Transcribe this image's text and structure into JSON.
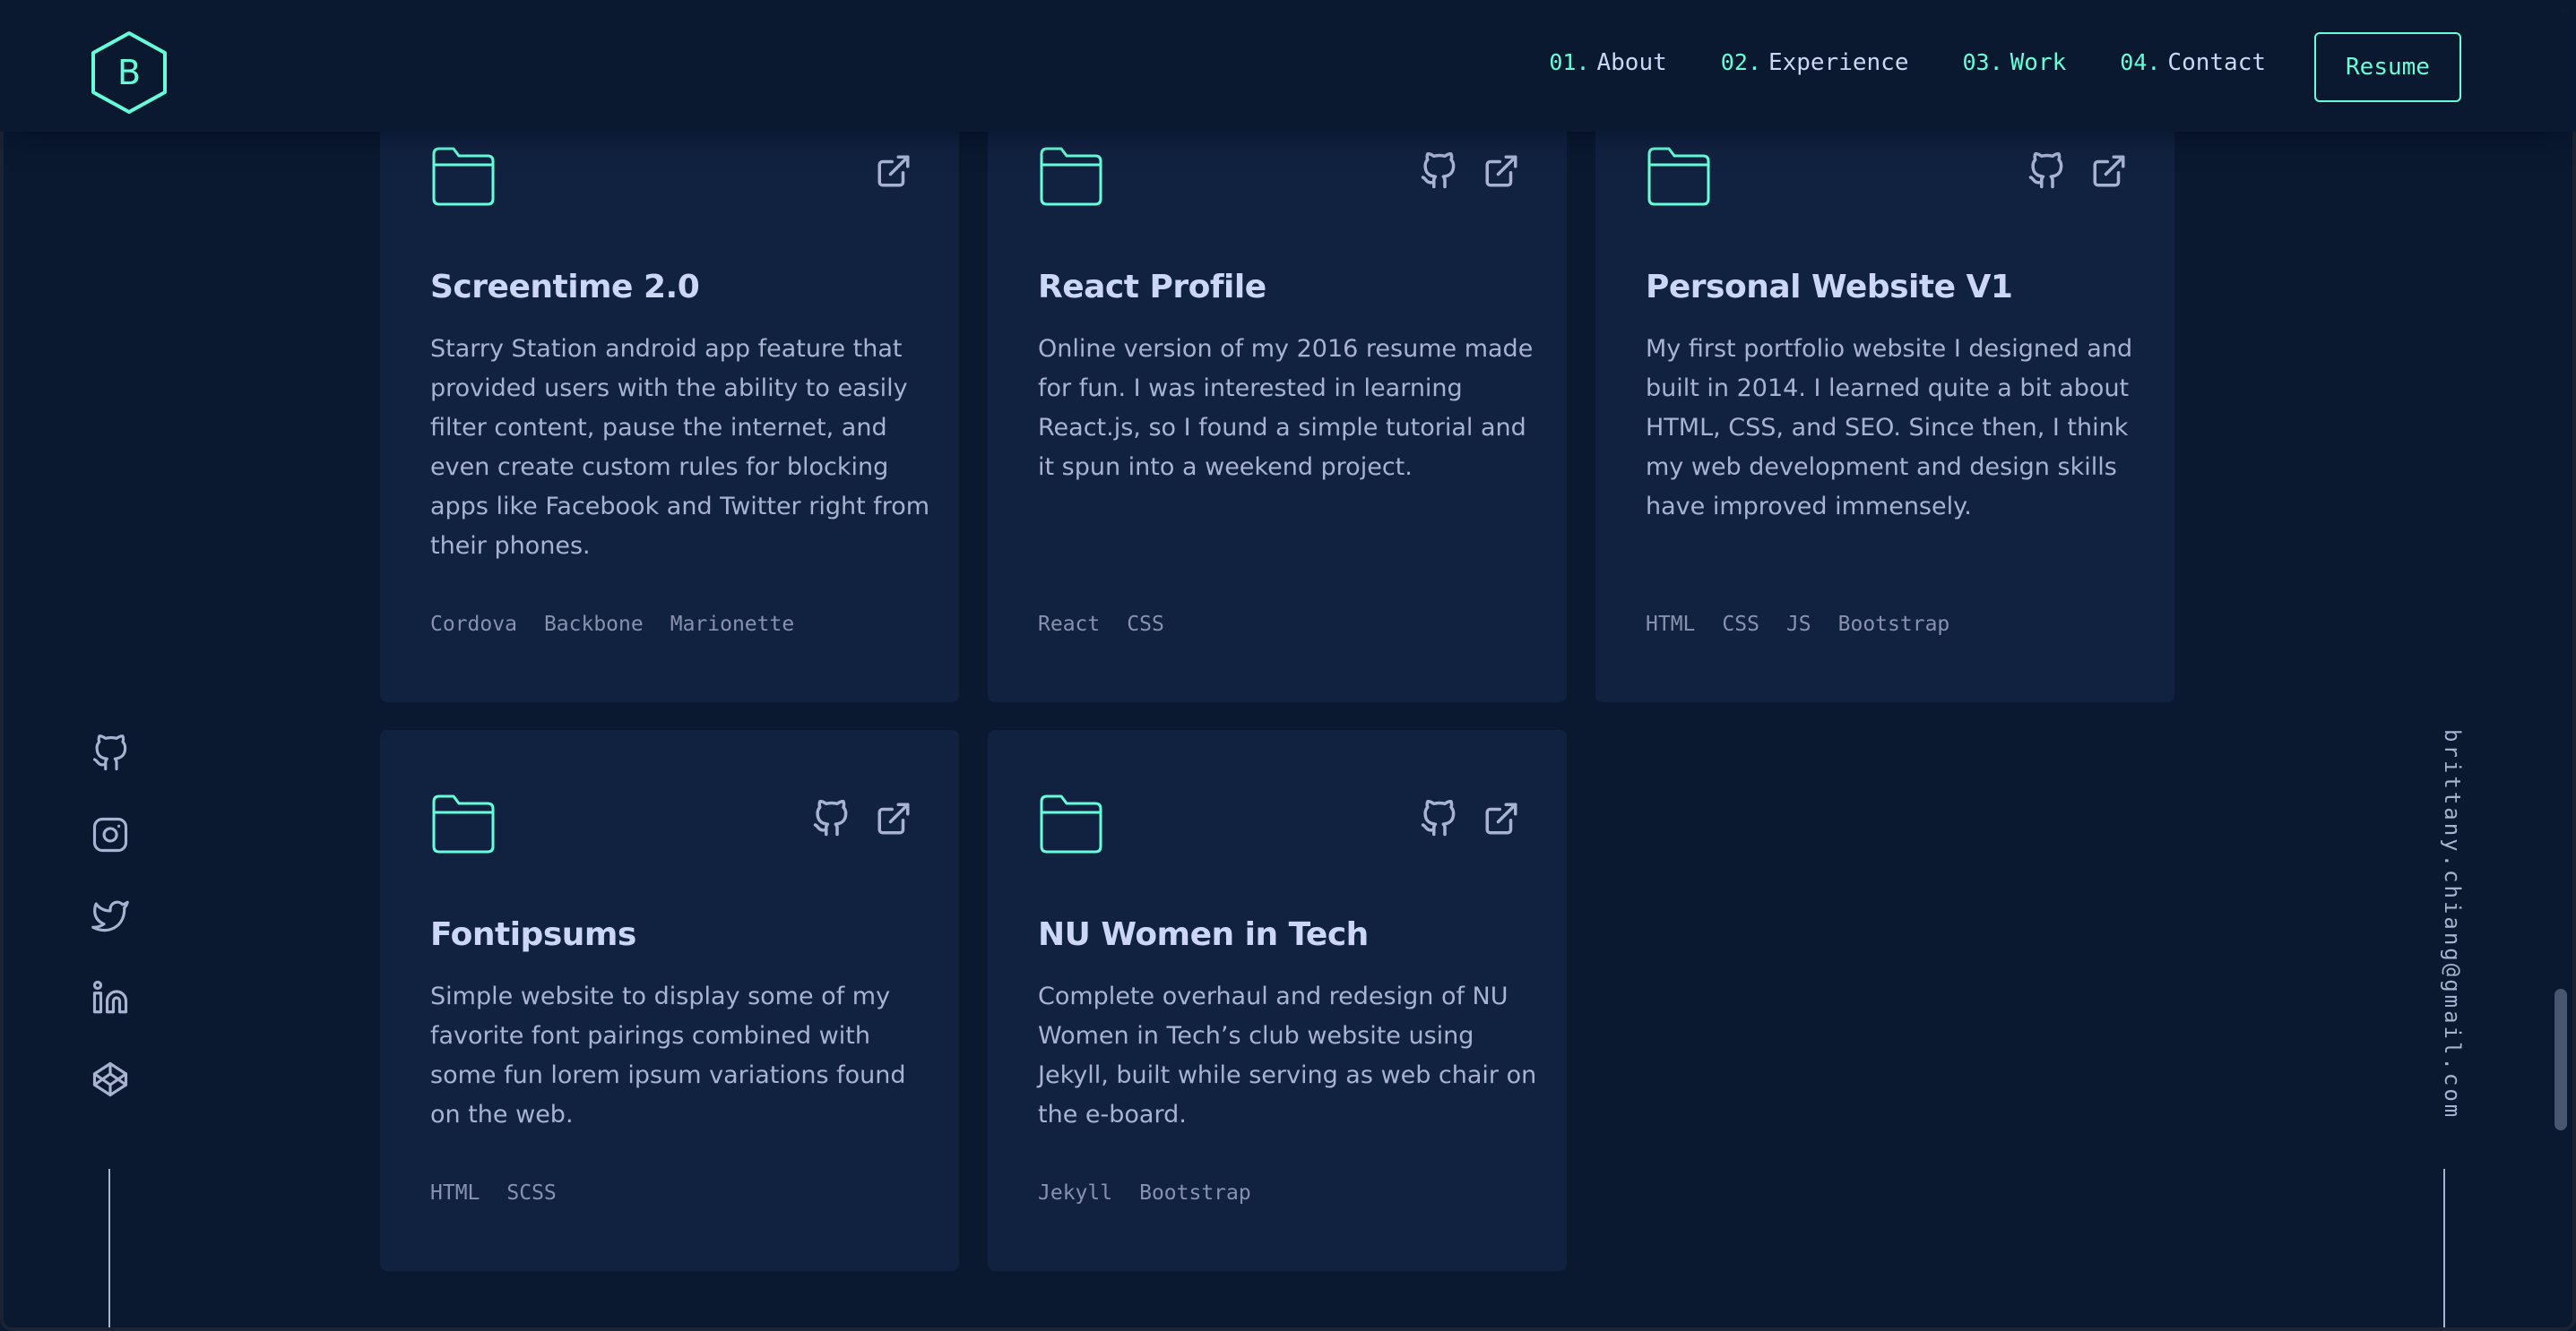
{
  "header": {
    "logo_letter": "B",
    "nav": [
      {
        "num": "01.",
        "label": "About"
      },
      {
        "num": "02.",
        "label": "Experience"
      },
      {
        "num": "03.",
        "label": "Work"
      },
      {
        "num": "04.",
        "label": "Contact"
      }
    ],
    "resume_label": "Resume"
  },
  "projects": [
    {
      "title": "Screentime 2.0",
      "description": "Starry Station android app feature that provided users with the ability to easily filter content, pause the internet, and even create custom rules for blocking apps like Facebook and Twitter right from their phones.",
      "tags": [
        "Cordova",
        "Backbone",
        "Marionette"
      ],
      "icons": [
        "external-link-icon"
      ]
    },
    {
      "title": "React Profile",
      "description": "Online version of my 2016 resume made for fun. I was interested in learning React.js, so I found a simple tutorial and it spun into a weekend project.",
      "tags": [
        "React",
        "CSS"
      ],
      "icons": [
        "github-icon",
        "external-link-icon"
      ]
    },
    {
      "title": "Personal Website V1",
      "description": "My first portfolio website I designed and built in 2014. I learned quite a bit about HTML, CSS, and SEO. Since then, I think my web development and design skills have improved immensely.",
      "tags": [
        "HTML",
        "CSS",
        "JS",
        "Bootstrap"
      ],
      "icons": [
        "github-icon",
        "external-link-icon"
      ]
    },
    {
      "title": "Fontipsums",
      "description": "Simple website to display some of my favorite font pairings combined with some fun lorem ipsum variations found on the web.",
      "tags": [
        "HTML",
        "SCSS"
      ],
      "icons": [
        "github-icon",
        "external-link-icon"
      ]
    },
    {
      "title": "NU Women in Tech",
      "description": "Complete overhaul and redesign of NU Women in Tech’s club website using Jekyll, built while serving as web chair on the e-board.",
      "tags": [
        "Jekyll",
        "Bootstrap"
      ],
      "icons": [
        "github-icon",
        "external-link-icon"
      ]
    }
  ],
  "social": [
    "github-icon",
    "instagram-icon",
    "twitter-icon",
    "linkedin-icon",
    "codepen-icon"
  ],
  "email": "brittany.chiang@gmail.com",
  "colors": {
    "background": "#0a192f",
    "card": "#112240",
    "accent": "#64ffda",
    "heading": "#ccd6f6",
    "body": "#a8b2d1",
    "muted": "#8892b0"
  }
}
